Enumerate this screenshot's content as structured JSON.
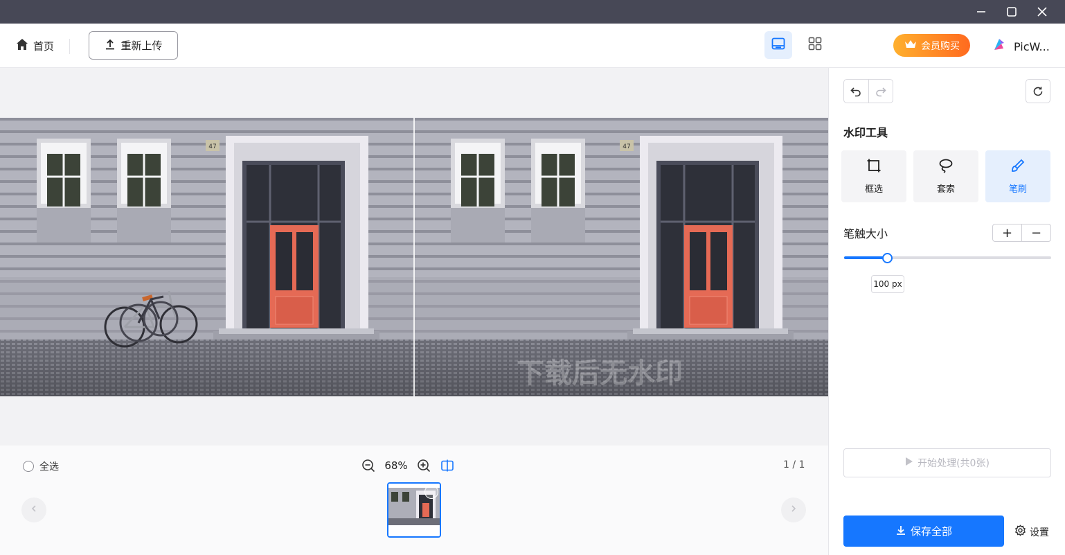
{
  "window": {
    "minimize_icon": "minimize-icon",
    "maximize_icon": "maximize-icon",
    "close_icon": "close-icon"
  },
  "toolbar": {
    "home_label": "首页",
    "reupload_label": "重新上传",
    "member_label": "会员购买",
    "brand_name": "PicW...",
    "view_modes": [
      "single-view",
      "grid-view"
    ],
    "active_view": "single-view"
  },
  "canvas": {
    "watermark_text": "下载后无水印",
    "house_number": "47"
  },
  "bottom": {
    "select_all_label": "全选",
    "zoom_percent": "68%",
    "page_indicator": "1 / 1"
  },
  "panel": {
    "title": "水印工具",
    "tools": [
      {
        "label": "框选",
        "icon": "rectangle-select-icon"
      },
      {
        "label": "套索",
        "icon": "lasso-icon"
      },
      {
        "label": "笔刷",
        "icon": "brush-icon"
      }
    ],
    "active_tool": "笔刷",
    "brush_size_label": "笔触大小",
    "plus_label": "+",
    "minus_label": "−",
    "brush_size_value": "100 px",
    "brush_size_fraction": 0.21,
    "start_label": "开始处理(共0张)",
    "save_label": "保存全部",
    "settings_label": "设置"
  },
  "colors": {
    "accent": "#1677ff",
    "titlebar": "#474856",
    "member_gradient_start": "#ffb02e",
    "member_gradient_end": "#ff6a1f"
  }
}
